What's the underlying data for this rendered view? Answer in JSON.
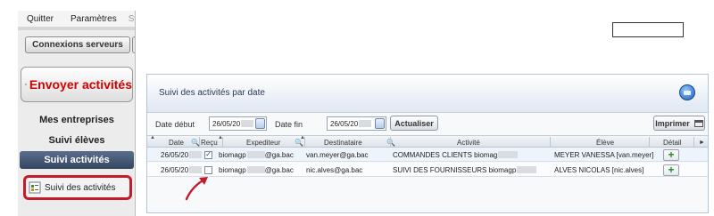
{
  "left_panel": {
    "menu": [
      "Quitter",
      "Paramètres",
      "Sys"
    ],
    "connexions_button": "Connexions serveurs",
    "envoyer_button": "Envoyer activités",
    "nav_items": [
      "Mes entreprises",
      "Suivi élèves"
    ],
    "active_section": "Suivi activités",
    "highlighted_link": "Suivi des activités"
  },
  "window": {
    "title": "Suivi des activités par date",
    "filters": {
      "date_debut_label": "Date début",
      "date_debut_value": "26/05/20",
      "date_fin_label": "Date fin",
      "date_fin_value": "26/05/20",
      "actualiser_button": "Actualiser",
      "imprimer_button": "Imprimer"
    },
    "columns": {
      "date": "Date",
      "recu": "Reçu",
      "expediteur": "Expediteur",
      "destinataire": "Destinataire",
      "activite": "Activité",
      "eleve": "Élève",
      "detail": "Détail"
    },
    "rows": [
      {
        "date": "26/05/20",
        "recu_checked": true,
        "recu_mark": "✓",
        "expediteur_prefix": "biomagp",
        "expediteur_suffix": "@ga.bac",
        "destinataire": "van.meyer@ga.bac",
        "activite_prefix": "COMMANDES CLIENTS biomag",
        "eleve": "MEYER VANESSA [van.meyer]",
        "detail": "+"
      },
      {
        "date": "26/05/20",
        "recu_checked": false,
        "recu_mark": "",
        "expediteur_prefix": "biomagp",
        "expediteur_suffix": "@ga.bac",
        "destinataire": "nic.alves@ga.bac",
        "activite_prefix": "SUIVI DES FOURNISSEURS biomagp",
        "eleve": "ALVES NICOLAS [nic.alves]",
        "detail": "+"
      }
    ]
  },
  "colors": {
    "accent_red": "#d40000",
    "highlight_border": "#c31b2a",
    "nav_active_bg": "#3b4d68",
    "add_green": "#1e8c1e"
  }
}
